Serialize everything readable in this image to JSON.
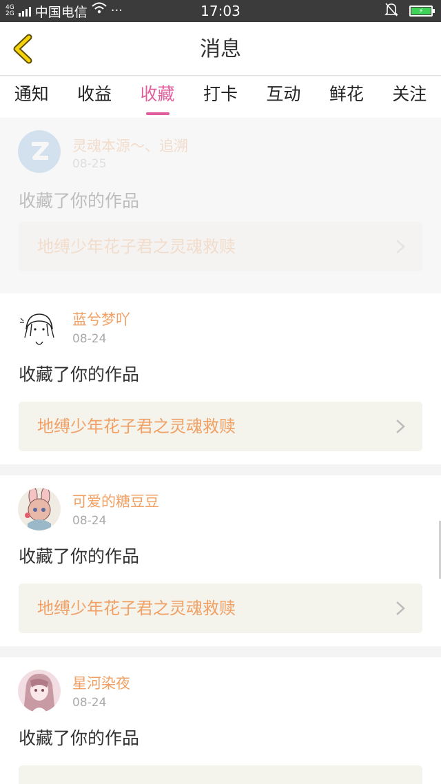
{
  "status_bar": {
    "net_type_top": "4G",
    "net_type_bottom": "2G",
    "carrier": "中国电信",
    "time": "17:03",
    "colors": {
      "background": "#3b3b3b",
      "battery_fill": "#3fd35a"
    },
    "icons": [
      "signal-icon",
      "wifi-icon",
      "more-icon",
      "bell-muted-icon",
      "battery-charging-icon"
    ]
  },
  "header": {
    "title": "消息",
    "back_icon": "back-chevron-icon",
    "back_color": "#f4d20c"
  },
  "tabs": [
    {
      "label": "通知",
      "active": false
    },
    {
      "label": "收益",
      "active": false
    },
    {
      "label": "收藏",
      "active": true
    },
    {
      "label": "打卡",
      "active": false
    },
    {
      "label": "互动",
      "active": false
    },
    {
      "label": "鲜花",
      "active": false
    },
    {
      "label": "关注",
      "active": false
    }
  ],
  "accent_color": "#e05f9c",
  "messages": [
    {
      "username": "灵魂本源～、追溯",
      "date": "08-25",
      "action": "收藏了你的作品",
      "work_title": "地缚少年花子君之灵魂救赎",
      "avatar": "default-avatar-icon",
      "faded": true
    },
    {
      "username": "蓝兮梦吖",
      "date": "08-24",
      "action": "收藏了你的作品",
      "work_title": "地缚少年花子君之灵魂救赎",
      "avatar": "avatar-sketch-girl-icon",
      "faded": false
    },
    {
      "username": "可爱的糖豆豆",
      "date": "08-24",
      "action": "收藏了你的作品",
      "work_title": "地缚少年花子君之灵魂救赎",
      "avatar": "avatar-bunny-girl-icon",
      "faded": false
    },
    {
      "username": "星河染夜",
      "date": "08-24",
      "action": "收藏了你的作品",
      "work_title": "",
      "avatar": "avatar-anime-girl-icon",
      "faded": false
    }
  ]
}
